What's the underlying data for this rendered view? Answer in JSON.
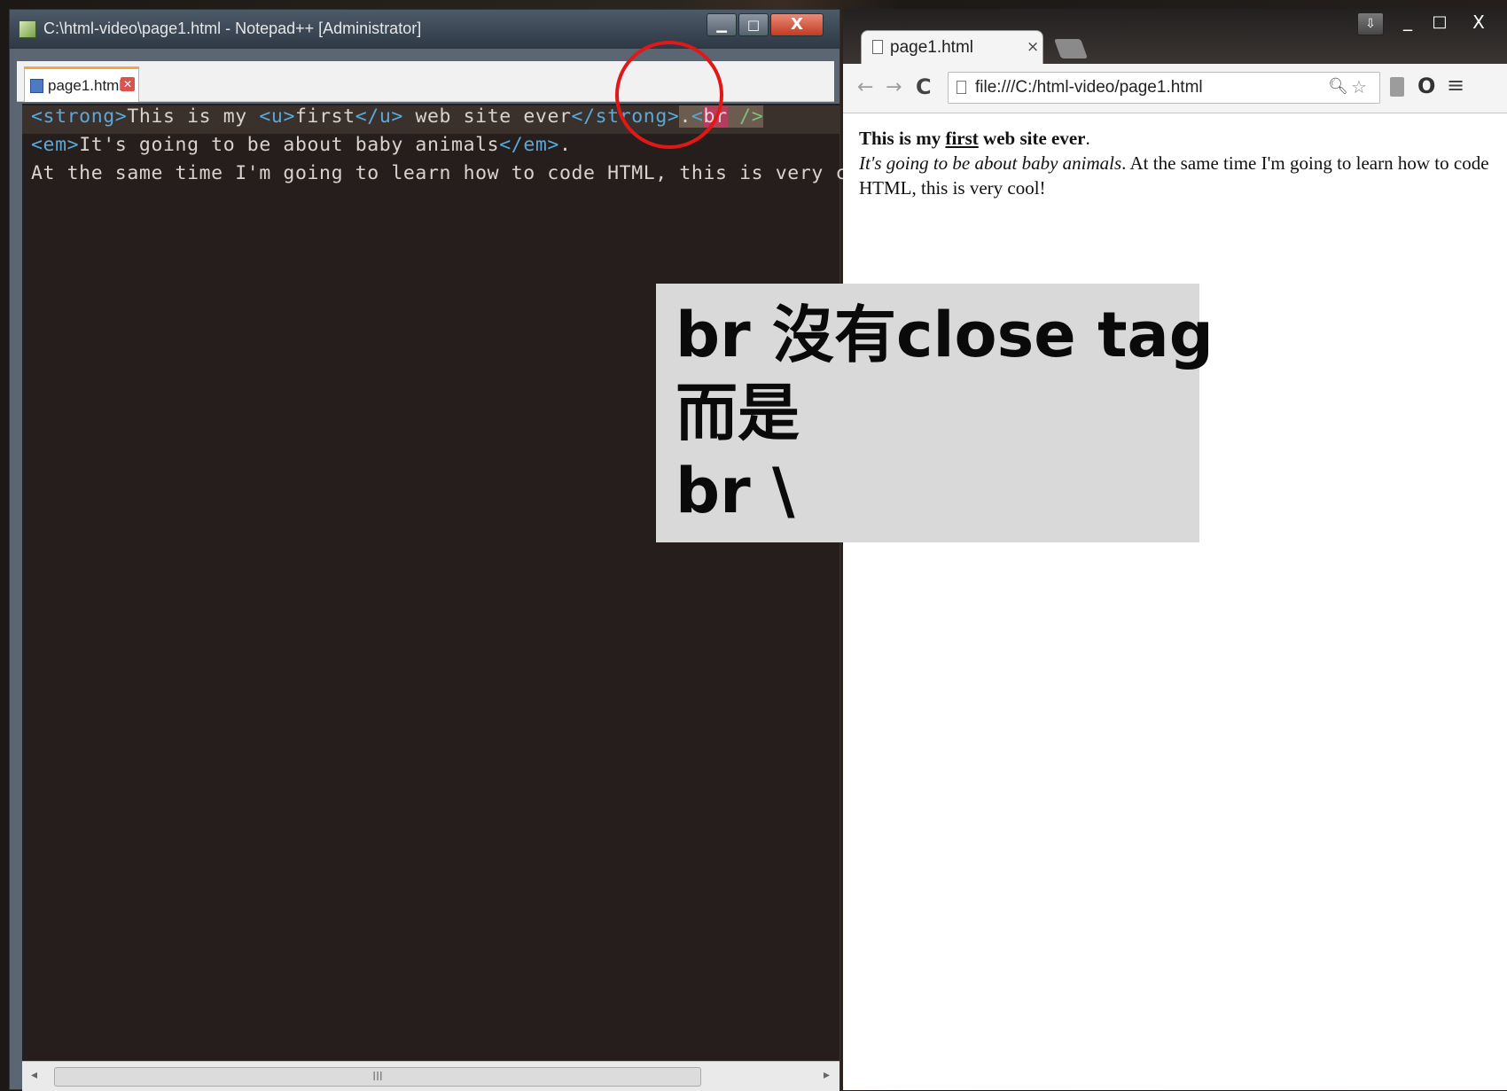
{
  "notepad": {
    "title": "C:\\html-video\\page1.html - Notepad++ [Administrator]",
    "tab_label": "page1.html",
    "close_glyph": "X",
    "code": {
      "l1_tag_open_strong": "<strong>",
      "l1_text1": "This is my ",
      "l1_tag_open_u": "<u>",
      "l1_word": "first",
      "l1_tag_close_u": "</u>",
      "l1_text2": " web site ever",
      "l1_tag_close_strong": "</strong>",
      "l1_dot": ".",
      "l1_lt": "<",
      "l1_br": "br",
      "l1_end": " />",
      "l2_tag_open_em": "<em>",
      "l2_text": "It's going to be about baby animals",
      "l2_tag_close_em": "</em>",
      "l2_dot": ".",
      "l3_text": "At the same time I'm going to learn how to code HTML, this is very cool!"
    },
    "scrollbar_grip": "III"
  },
  "browser": {
    "tab_title": "page1.html",
    "tab_close": "×",
    "url": "file:///C:/html-video/page1.html",
    "back_glyph": "←",
    "forward_glyph": "→",
    "reload_glyph": "C",
    "ext_glyph": "O",
    "menu_glyph": "≡",
    "close_glyph": "X",
    "content": {
      "strong_pre": "This is my ",
      "strong_u": "first",
      "strong_post": " web site ever",
      "dot1": ".",
      "em_text": "It's going to be about baby animals",
      "rest": ". At the same time I'm going to learn how to code HTML, this is very cool!"
    }
  },
  "overlay": {
    "line1": "br 沒有close tag",
    "line2": "而是",
    "line3": "br \\"
  },
  "colors": {
    "editor_bg": "#261e1c",
    "tag_blue": "#5aa9d8",
    "highlight_red_circle": "#e01818"
  }
}
